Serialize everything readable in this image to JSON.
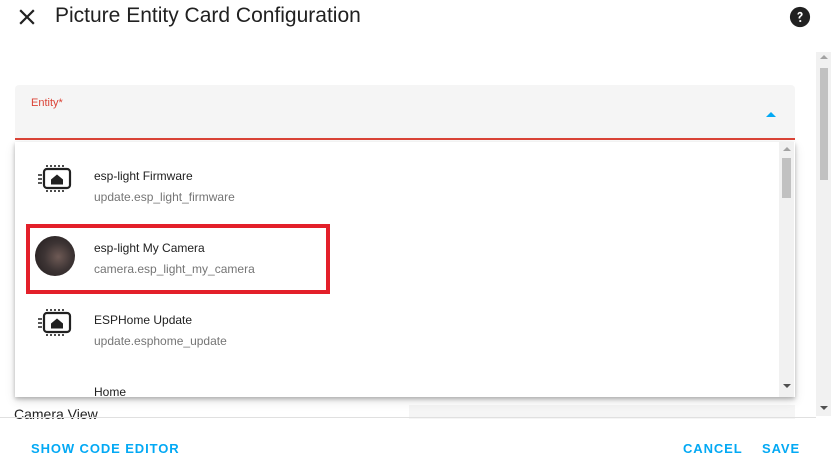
{
  "dialog": {
    "title": "Picture Entity Card Configuration"
  },
  "entity_field": {
    "label": "Entity*",
    "value": ""
  },
  "dropdown": {
    "items": [
      {
        "primary": "esp-light Firmware",
        "secondary": "update.esp_light_firmware",
        "icon": "chip-home-icon"
      },
      {
        "primary": "esp-light My Camera",
        "secondary": "camera.esp_light_my_camera",
        "icon": "camera-thumbnail",
        "highlighted": true
      },
      {
        "primary": "ESPHome Update",
        "secondary": "update.esphome_update",
        "icon": "chip-home-icon"
      },
      {
        "primary": "Home",
        "secondary": "",
        "icon": "home-icon"
      }
    ]
  },
  "background": {
    "camera_view_label": "Camera View"
  },
  "footer": {
    "show_code_editor": "SHOW CODE EDITOR",
    "cancel": "CANCEL",
    "save": "SAVE"
  },
  "colors": {
    "accent": "#03a9f4",
    "error": "#db4437",
    "highlight": "#e3202a"
  }
}
